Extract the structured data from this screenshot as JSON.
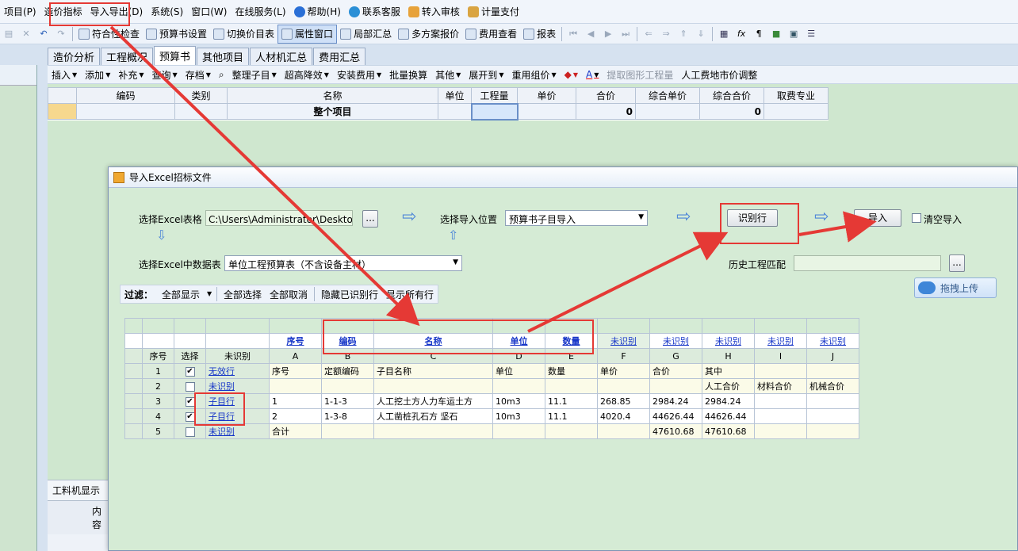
{
  "menubar": {
    "items": [
      "项目(P)",
      "造价指标",
      "导入导出(D)",
      "系统(S)",
      "窗口(W)",
      "在线服务(L)",
      "帮助(H)",
      "联系客服",
      "转入审核",
      "计量支付"
    ]
  },
  "toolbar1": {
    "items": [
      "符合性检查",
      "预算书设置",
      "切换价目表",
      "属性窗口",
      "局部汇总",
      "多方案报价",
      "费用查看",
      "报表"
    ]
  },
  "tabs": [
    "造价分析",
    "工程概况",
    "预算书",
    "其他项目",
    "人材机汇总",
    "费用汇总"
  ],
  "active_tab": "预算书",
  "toolbar2": {
    "items": [
      "插入",
      "添加",
      "补充",
      "查询",
      "存档",
      "整理子目",
      "超高降效",
      "安装费用",
      "批量换算",
      "其他",
      "展开到",
      "重用组价",
      "提取图形工程量",
      "人工费地市价调整"
    ]
  },
  "main_grid": {
    "headers": [
      "编码",
      "类别",
      "名称",
      "单位",
      "工程量",
      "单价",
      "合价",
      "综合单价",
      "综合合价",
      "取费专业"
    ],
    "row": {
      "name": "整个项目",
      "heji": "0",
      "zonghe_heji": "0"
    }
  },
  "bottom_panel": {
    "title": "工料机显示",
    "col": "内容"
  },
  "dialog": {
    "title": "导入Excel招标文件",
    "select_excel_label": "选择Excel表格",
    "excel_path": "C:\\Users\\Administrator\\Desktop\\单位",
    "browse": "...",
    "import_pos_label": "选择导入位置",
    "import_pos_value": "预算书子目导入",
    "identify_btn": "识别行",
    "import_btn": "导入",
    "clear_import_label": "清空导入",
    "sheet_label": "选择Excel中数据表",
    "sheet_value": "单位工程预算表（不含设备主材）",
    "history_label": "历史工程匹配",
    "history_browse": "...",
    "upload_btn": "拖拽上传",
    "filter": {
      "label": "过滤：",
      "value": "全部显示",
      "items": [
        "全部选择",
        "全部取消",
        "隐藏已识别行",
        "显示所有行"
      ]
    },
    "grid": {
      "side_headers": [
        "序号",
        "选择",
        "未识别"
      ],
      "col_links": [
        "序号",
        "编码",
        "名称",
        "单位",
        "数量",
        "未识别",
        "未识别",
        "未识别",
        "未识别",
        "未识别"
      ],
      "col_letters": [
        "A",
        "B",
        "C",
        "D",
        "E",
        "F",
        "G",
        "H",
        "I",
        "J"
      ],
      "rows": [
        {
          "no": "1",
          "checked": true,
          "type": "无效行",
          "cells": [
            "序号",
            "定额编码",
            "子目名称",
            "单位",
            "数量",
            "单价",
            "合价",
            "其中",
            "",
            ""
          ]
        },
        {
          "no": "2",
          "checked": false,
          "type": "未识别",
          "cells": [
            "",
            "",
            "",
            "",
            "",
            "",
            "",
            "人工合价",
            "材料合价",
            "机械合价"
          ]
        },
        {
          "no": "3",
          "checked": true,
          "type": "子目行",
          "cells": [
            "1",
            "1-1-3",
            "人工挖土方人力车运土方",
            "10m3",
            "11.1",
            "268.85",
            "2984.24",
            "2984.24",
            "",
            ""
          ]
        },
        {
          "no": "4",
          "checked": true,
          "type": "子目行",
          "cells": [
            "2",
            "1-3-8",
            "人工凿桩孔石方 坚石",
            "10m3",
            "11.1",
            "4020.4",
            "44626.44",
            "44626.44",
            "",
            ""
          ]
        },
        {
          "no": "5",
          "checked": false,
          "type": "未识别",
          "cells": [
            "合计",
            "",
            "",
            "",
            "",
            "",
            "47610.68",
            "47610.68",
            "",
            ""
          ]
        }
      ]
    }
  },
  "colors": {
    "highlight": "#e53935",
    "grid_green": "#d5ebd5",
    "link": "#1736c8",
    "orange": "#f6d88e"
  }
}
